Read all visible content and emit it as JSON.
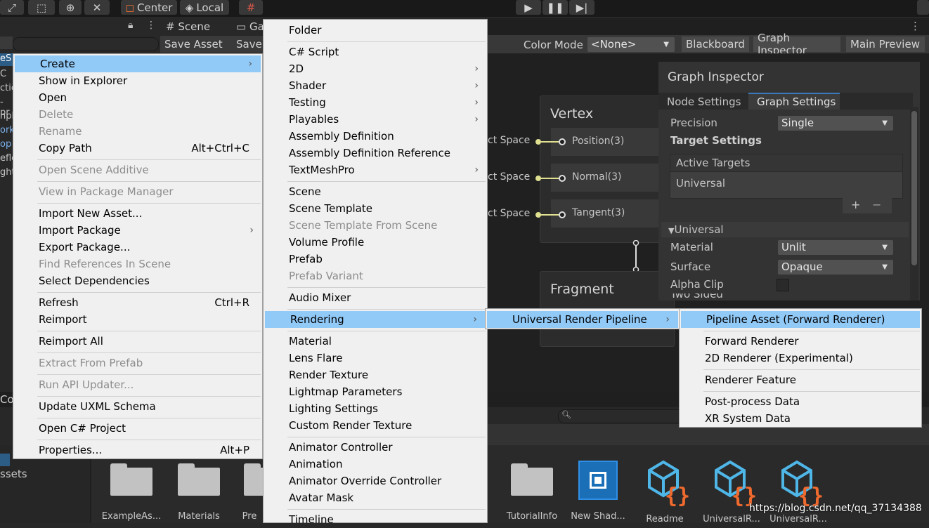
{
  "toolbar": {
    "center_label": "Center",
    "local_label": "Local"
  },
  "scene": {
    "tab_scene": "Scene",
    "tab_game": "Ga",
    "save_asset": "Save Asset",
    "save_as": "Save"
  },
  "hierarchy": {
    "fragments": [
      "eS",
      "C",
      "ctic",
      "-pr",
      "npl",
      "ork",
      "op",
      "efle",
      "ght"
    ]
  },
  "graph": {
    "color_mode_label": "Color Mode",
    "color_mode_value": "<None>",
    "blackboard": "Blackboard",
    "graph_inspector": "Graph Inspector",
    "main_preview": "Main Preview",
    "vertex_title": "Vertex",
    "fragment_title": "Fragment",
    "vertex_ports": [
      {
        "space": "ct Space",
        "name": "Position(3)"
      },
      {
        "space": "ct Space",
        "name": "Normal(3)"
      },
      {
        "space": "ct Space",
        "name": "Tangent(3)"
      }
    ]
  },
  "inspector": {
    "title": "Graph Inspector",
    "tab_node": "Node Settings",
    "tab_graph": "Graph Settings",
    "precision_label": "Precision",
    "precision_value": "Single",
    "target_settings": "Target Settings",
    "active_targets": "Active Targets",
    "target_universal": "Universal",
    "universal_section": "Universal",
    "material_label": "Material",
    "material_value": "Unlit",
    "surface_label": "Surface",
    "surface_value": "Opaque",
    "alpha_clip": "Alpha Clip",
    "two_sided": "Two Sided"
  },
  "context_menu": {
    "items": [
      {
        "label": "Create",
        "arrow": true,
        "highlight": true
      },
      {
        "label": "Show in Explorer"
      },
      {
        "label": "Open"
      },
      {
        "label": "Delete",
        "disabled": true
      },
      {
        "label": "Rename",
        "disabled": true
      },
      {
        "label": "Copy Path",
        "shortcut": "Alt+Ctrl+C"
      },
      {
        "label": "Open Scene Additive",
        "disabled": true
      },
      {
        "label": "View in Package Manager",
        "disabled": true
      },
      {
        "label": "Import New Asset..."
      },
      {
        "label": "Import Package",
        "arrow": true
      },
      {
        "label": "Export Package..."
      },
      {
        "label": "Find References In Scene",
        "disabled": true
      },
      {
        "label": "Select Dependencies"
      },
      {
        "label": "Refresh",
        "shortcut": "Ctrl+R"
      },
      {
        "label": "Reimport"
      },
      {
        "label": "Reimport All"
      },
      {
        "label": "Extract From Prefab",
        "disabled": true
      },
      {
        "label": "Run API Updater...",
        "disabled": true
      },
      {
        "label": "Update UXML Schema"
      },
      {
        "label": "Open C# Project"
      },
      {
        "label": "Properties...",
        "shortcut": "Alt+P"
      }
    ]
  },
  "create_menu": {
    "items": [
      {
        "label": "Folder"
      },
      {
        "label": "C# Script"
      },
      {
        "label": "2D",
        "arrow": true
      },
      {
        "label": "Shader",
        "arrow": true
      },
      {
        "label": "Testing",
        "arrow": true
      },
      {
        "label": "Playables",
        "arrow": true
      },
      {
        "label": "Assembly Definition"
      },
      {
        "label": "Assembly Definition Reference"
      },
      {
        "label": "TextMeshPro",
        "arrow": true
      },
      {
        "label": "Scene"
      },
      {
        "label": "Scene Template"
      },
      {
        "label": "Scene Template From Scene",
        "disabled": true
      },
      {
        "label": "Volume Profile"
      },
      {
        "label": "Prefab"
      },
      {
        "label": "Prefab Variant",
        "disabled": true
      },
      {
        "label": "Audio Mixer"
      },
      {
        "label": "Rendering",
        "arrow": true,
        "highlight": true
      },
      {
        "label": "Material"
      },
      {
        "label": "Lens Flare"
      },
      {
        "label": "Render Texture"
      },
      {
        "label": "Lightmap Parameters"
      },
      {
        "label": "Lighting Settings"
      },
      {
        "label": "Custom Render Texture"
      },
      {
        "label": "Animator Controller"
      },
      {
        "label": "Animation"
      },
      {
        "label": "Animator Override Controller"
      },
      {
        "label": "Avatar Mask"
      },
      {
        "label": "Timeline"
      }
    ]
  },
  "rendering_menu": {
    "items": [
      {
        "label": "Universal Render Pipeline",
        "arrow": true,
        "highlight": true
      }
    ]
  },
  "urp_menu": {
    "items": [
      {
        "label": "Pipeline Asset (Forward Renderer)",
        "highlight": true
      },
      {
        "label": "Forward Renderer"
      },
      {
        "label": "2D Renderer (Experimental)"
      },
      {
        "label": "Renderer Feature"
      },
      {
        "label": "Post-process Data"
      },
      {
        "label": "XR System Data"
      }
    ]
  },
  "project": {
    "tab_fragment": "Co",
    "assets_label": "ssets",
    "assets": [
      {
        "label": "ExampleAs...",
        "kind": "folder"
      },
      {
        "label": "Materials",
        "kind": "folder"
      },
      {
        "label": "Pre",
        "kind": "folder"
      },
      {
        "label": "TutorialInfo",
        "kind": "folder"
      },
      {
        "label": "New Shad...",
        "kind": "shadergraph"
      },
      {
        "label": "Readme",
        "kind": "script"
      },
      {
        "label": "UniversalR...",
        "kind": "script"
      },
      {
        "label": "UniversalR...",
        "kind": "script"
      }
    ]
  },
  "watermark": "https://blog.csdn.net/qq_37134388"
}
